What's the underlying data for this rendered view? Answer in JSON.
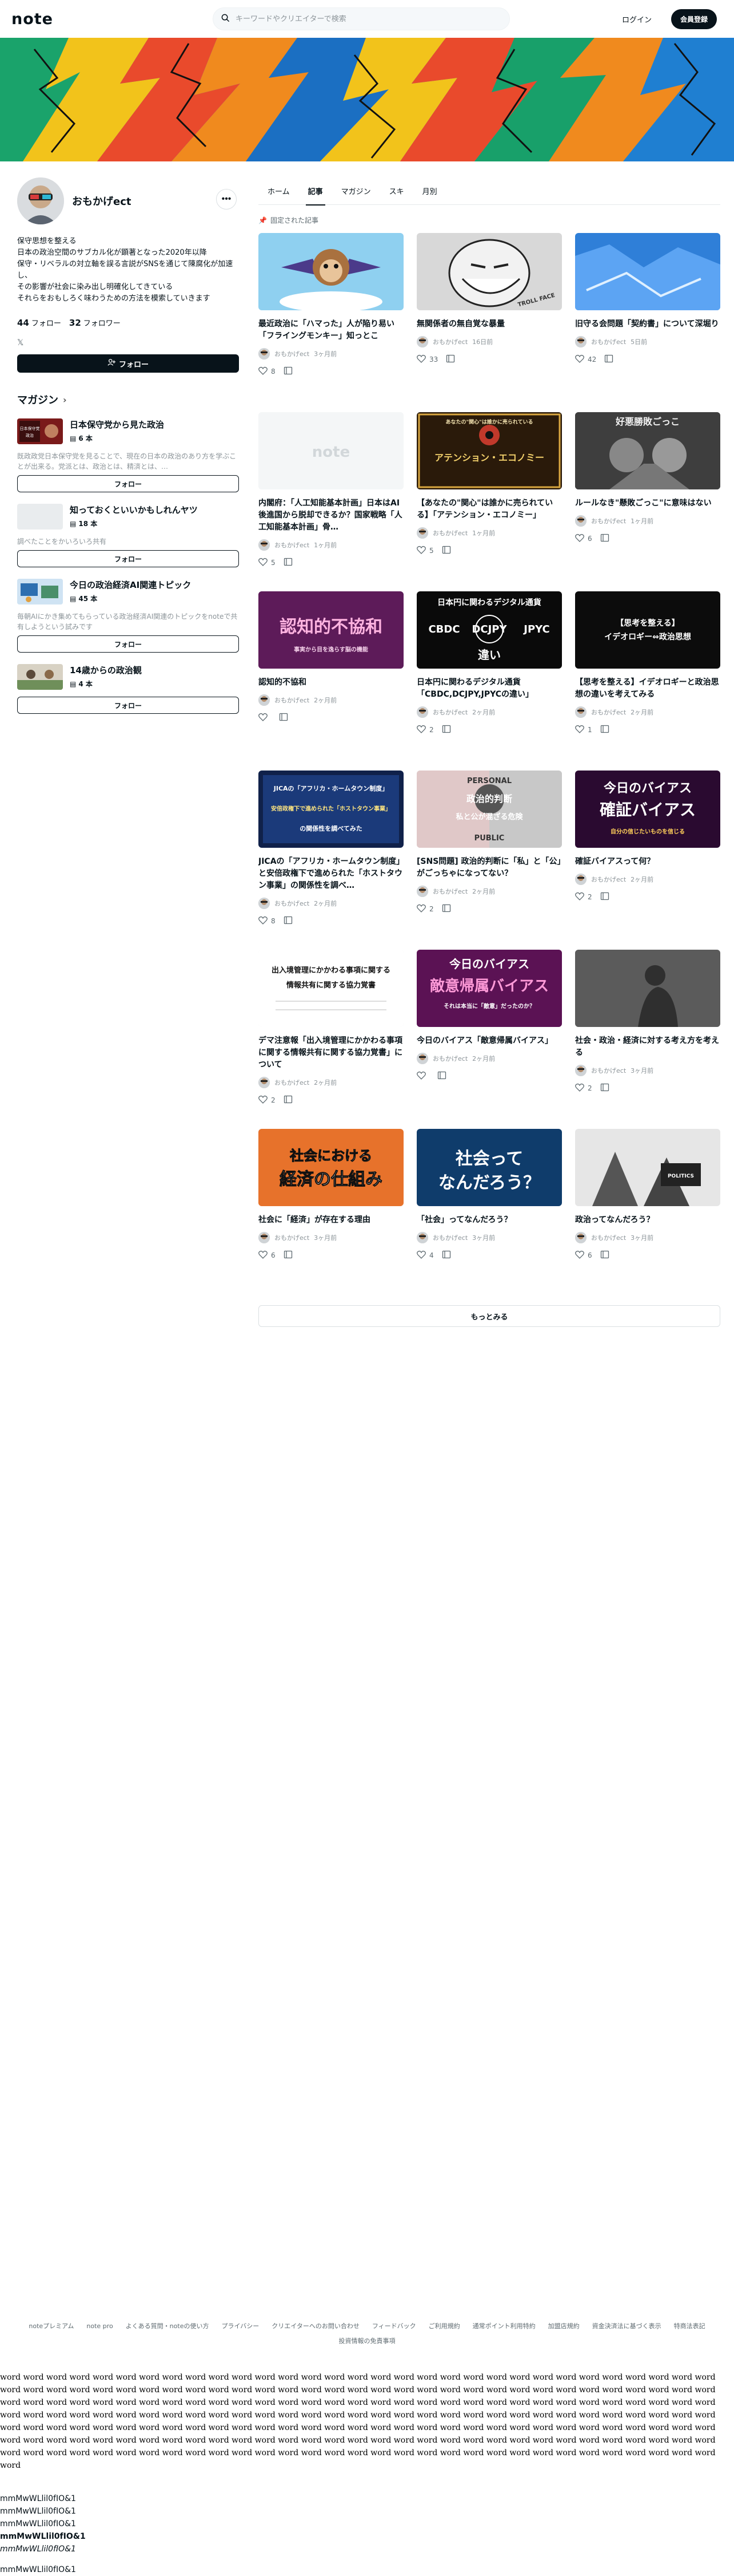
{
  "header": {
    "logo": "note",
    "search_placeholder": "キーワードやクリエイターで検索",
    "login": "ログイン",
    "signup": "会員登録"
  },
  "profile": {
    "name": "おもかげect",
    "bio": "保守思想を整える\n日本の政治空間のサブカル化が顕著となった2020年以降\n保守・リベラルの対立軸を誤る言説がSNSを通じて陳腐化が加速し、\nその影響が社会に染み出し明確化してきている\nそれらをおもしろく味わうための方法を模索していきます",
    "follows_count": "44",
    "follows_label": "フォロー",
    "followers_count": "32",
    "followers_label": "フォロワー",
    "follow_button": "フォロー"
  },
  "magazines_heading": "マガジン",
  "magazines": [
    {
      "title": "日本保守党から見た政治",
      "count": "6 本",
      "desc": "既政政党日本保守党を見ることで、現在の日本の政治のあり方を学ぶことが出来る。党派とは、政治とは、精済とは、…",
      "follow": "フォロー",
      "thumb_text": "日本保守党から見た政治"
    },
    {
      "title": "知っておくといいかもしれんヤツ",
      "count": "18 本",
      "desc": "調べたことをかいろいろ共有",
      "follow": "フォロー",
      "thumb_text": ""
    },
    {
      "title": "今日の政治経済AI関連トピック",
      "count": "45 本",
      "desc": "毎朝AIにかき集めてもらっている政治経済AI関連のトピックをnoteで共有しようという試みです",
      "follow": "フォロー",
      "thumb_text": ""
    },
    {
      "title": "14歳からの政治観",
      "count": "4 本",
      "desc": "",
      "follow": "フォロー",
      "thumb_text": ""
    }
  ],
  "tabs": [
    "ホーム",
    "記事",
    "マガジン",
    "スキ",
    "月別"
  ],
  "active_tab": "記事",
  "pinned_label": "固定された記事",
  "articles": [
    {
      "title": "最近政治に「ハマった」人が陥り易い「フライングモンキー」知っとこ",
      "author": "おもかげect",
      "time": "3ヶ月前",
      "likes": "8",
      "thumb": "monkey"
    },
    {
      "title": "無関係者の無自覚な暴量",
      "author": "おもかげect",
      "time": "16日前",
      "likes": "33",
      "thumb": "troll"
    },
    {
      "title": "旧守る会問題「契約書」について深堀り",
      "author": "おもかげect",
      "time": "5日前",
      "likes": "42",
      "thumb": "ice"
    },
    {
      "title": "内閣府：「人工知能基本計画」日本はAI後進国から脱却できるか？国家戦略「人工知能基本計画」骨…",
      "author": "おもかげect",
      "time": "1ヶ月前",
      "likes": "5",
      "thumb": "note"
    },
    {
      "title": "【あなたの\"関心\"は誰かに売られている】「アテンション・エコノミー」",
      "author": "おもかげect",
      "time": "1ヶ月前",
      "likes": "5",
      "thumb": "attention"
    },
    {
      "title": "ルールなき\"懸敗ごっこ\"に意味はない",
      "author": "おもかげect",
      "time": "1ヶ月前",
      "likes": "6",
      "thumb": "wrestle"
    },
    {
      "title": "認知的不協和",
      "author": "おもかげect",
      "time": "2ヶ月前",
      "likes": "",
      "thumb": "cognitive"
    },
    {
      "title": "日本円に関わるデジタル通貨「CBDC,DCJPY,JPYCの違い」",
      "author": "おもかげect",
      "time": "2ヶ月前",
      "likes": "2",
      "thumb": "cbdc"
    },
    {
      "title": "【思考を整える】イデオロギーと政治思想の違いを考えてみる",
      "author": "おもかげect",
      "time": "2ヶ月前",
      "likes": "1",
      "thumb": "ideology"
    },
    {
      "title": "JICAの「アフリカ・ホームタウン制度」と安倍政権下で進められた「ホストタウン事業」の関係性を調べ…",
      "author": "おもかげect",
      "time": "2ヶ月前",
      "likes": "8",
      "thumb": "jica"
    },
    {
      "title": "[SNS問題] 政治的判断に「私」と「公」がごっちゃになってない？",
      "author": "おもかげect",
      "time": "2ヶ月前",
      "likes": "2",
      "thumb": "personal"
    },
    {
      "title": "確証バイアスって何？",
      "author": "おもかげect",
      "time": "2ヶ月前",
      "likes": "2",
      "thumb": "bias"
    },
    {
      "title": "デマ注意報「出入境管理にかかわる事項に関する情報共有に関する協力覚書」について",
      "author": "おもかげect",
      "time": "2ヶ月前",
      "likes": "2",
      "thumb": "memo"
    },
    {
      "title": "今日のバイアス「敵意帰属バイアス」",
      "author": "おもかげect",
      "time": "2ヶ月前",
      "likes": "",
      "thumb": "hostile"
    },
    {
      "title": "社会・政治・経済に対する考え方を考える",
      "author": "おもかげect",
      "time": "3ヶ月前",
      "likes": "2",
      "thumb": "thinker"
    },
    {
      "title": "社会に「経済」が存在する理由",
      "author": "おもかげect",
      "time": "3ヶ月前",
      "likes": "6",
      "thumb": "economy"
    },
    {
      "title": "「社会」ってなんだろう？",
      "author": "おもかげect",
      "time": "3ヶ月前",
      "likes": "4",
      "thumb": "society"
    },
    {
      "title": "政治ってなんだろう？",
      "author": "おもかげect",
      "time": "3ヶ月前",
      "likes": "6",
      "thumb": "politics"
    }
  ],
  "thumb_text": {
    "troll": "TROLL FACE",
    "attention": "アテンション・エコノミー",
    "attention_sub": "あなたの\"関心\"は誰かに売られている",
    "wrestle": "好悪勝敗ごっこ",
    "cognitive": "認知的不協和",
    "cognitive_sub": "事実から目を逸らす脳の機能",
    "cbdc_top": "日本円に関わるデジタル通貨",
    "cbdc_a": "CBDC",
    "cbdc_b": "DCJPY",
    "cbdc_c": "JPYC",
    "cbdc_bottom": "違い",
    "ideology_a": "【思考を整える】",
    "ideology_b": "イデオロギー⇔政治思想",
    "jica_a": "JICAの「アフリカ・ホームタウン制度」",
    "jica_b": "安倍政権下で進められた「ホストタウン事業」",
    "jica_c": "の関係性を調べてみた",
    "personal_a": "PERSONAL",
    "personal_b": "政治的判断",
    "personal_c": "私と公が混ざる危険",
    "personal_d": "PUBLIC",
    "bias_a": "今日のバイアス",
    "bias_b": "確証バイアス",
    "bias_c": "自分の信じたいものを信じる",
    "memo_a": "出入境管理にかかわる事項に関する",
    "memo_b": "情報共有に関する協力覚書",
    "hostile_a": "今日のバイアス",
    "hostile_b": "敵意帰属バイアス",
    "hostile_c": "それは本当に「敵意」だったのか？",
    "economy_a": "社会における",
    "economy_b": "経済の仕組み",
    "society_a": "社会って",
    "society_b": "なんだろう？",
    "politics": "POLITICS"
  },
  "more_button": "もっとみる",
  "footer_links": [
    "noteプレミアム",
    "note pro",
    "よくある質問・noteの使い方",
    "プライバシー",
    "クリエイターへのお問い合わせ",
    "フィードバック",
    "ご利用規約",
    "通常ポイント利用特約",
    "加盟店規約",
    "資金決済法に基づく表示",
    "特商法表記",
    "投資情報の免責事項"
  ],
  "filler_text": "word word word word word word word word word word word word word word word word word word word word word word word word word word word word word word word word word word word word word word word word word word word word word word word word word word word word word word word word word word word word word word word word word word word word word word word word word word word word word word word word word word word word word word word word word word word word word word word word word word word word word word word word word word word word word word word word word word word word word word word word word word word word word word word word word word word word word word word word word word word word word word word word word word word word word word word word word word word word word word word word word word word word word word word word word word word word word word word word word word word word word word word word word word word word word word word word word word word word word word word word word word word word word word word word word word word word word word word word word word",
  "measure_lines": [
    "mmMwWLlil0fIO&1",
    "mmMwWLlil0fIO&1",
    "mmMwWLlil0fIO&1",
    "mmMwWLlil0fIO&1",
    "mmMwWLlil0fIO&1"
  ],
  "measure_tail": "mmMwWLlil0fIO&1"
}
